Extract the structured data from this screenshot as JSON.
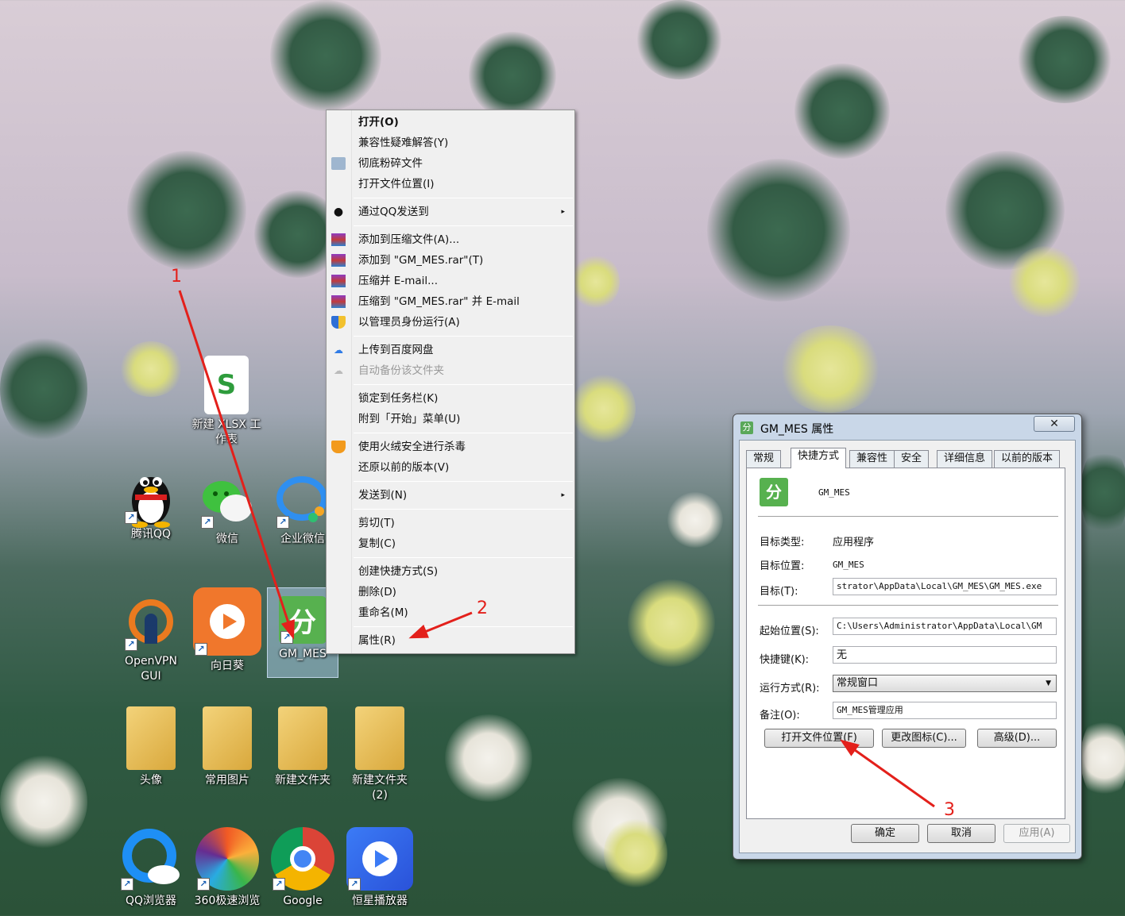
{
  "desktop": {
    "icons": [
      {
        "label": "新建 XLSX 工作表",
        "icon": "xlsx-file-icon"
      },
      {
        "label": "腾讯QQ",
        "icon": "qq-penguin-icon"
      },
      {
        "label": "微信",
        "icon": "wechat-icon"
      },
      {
        "label": "企业微信",
        "icon": "wecom-icon"
      },
      {
        "label": "OpenVPN GUI",
        "icon": "openvpn-icon"
      },
      {
        "label": "向日葵",
        "icon": "sunflower-icon"
      },
      {
        "label": "GM_MES",
        "icon": "gm-mes-app-icon"
      },
      {
        "label": "头像",
        "icon": "folder-icon"
      },
      {
        "label": "常用图片",
        "icon": "folder-icon"
      },
      {
        "label": "新建文件夹",
        "icon": "folder-icon"
      },
      {
        "label": "新建文件夹 (2)",
        "icon": "folder-icon"
      },
      {
        "label": "QQ浏览器",
        "icon": "qq-browser-icon"
      },
      {
        "label": "360极速浏览",
        "icon": "browser-360-icon"
      },
      {
        "label": "Google",
        "icon": "chrome-icon"
      },
      {
        "label": "恒星播放器",
        "icon": "video-player-icon"
      }
    ]
  },
  "context_menu": {
    "items": [
      {
        "label": "打开(O)",
        "bold": true
      },
      {
        "label": "兼容性疑难解答(Y)"
      },
      {
        "label": "彻底粉碎文件",
        "icon": "shredder-icon"
      },
      {
        "label": "打开文件位置(I)"
      },
      {
        "label": "通过QQ发送到",
        "icon": "qq-icon",
        "submenu": true
      },
      {
        "label": "添加到压缩文件(A)...",
        "icon": "winrar-icon"
      },
      {
        "label": "添加到 \"GM_MES.rar\"(T)",
        "icon": "winrar-icon"
      },
      {
        "label": "压缩并 E-mail...",
        "icon": "winrar-icon"
      },
      {
        "label": "压缩到 \"GM_MES.rar\" 并 E-mail",
        "icon": "winrar-icon"
      },
      {
        "label": "以管理员身份运行(A)",
        "icon": "uac-shield-icon"
      },
      {
        "label": "上传到百度网盘",
        "icon": "baidu-cloud-icon"
      },
      {
        "label": "自动备份该文件夹",
        "icon": "baidu-cloud-icon",
        "disabled": true
      },
      {
        "label": "锁定到任务栏(K)"
      },
      {
        "label": "附到「开始」菜单(U)"
      },
      {
        "label": "使用火绒安全进行杀毒",
        "icon": "huorong-icon"
      },
      {
        "label": "还原以前的版本(V)"
      },
      {
        "label": "发送到(N)",
        "submenu": true
      },
      {
        "label": "剪切(T)"
      },
      {
        "label": "复制(C)"
      },
      {
        "label": "创建快捷方式(S)"
      },
      {
        "label": "删除(D)"
      },
      {
        "label": "重命名(M)"
      },
      {
        "label": "属性(R)"
      }
    ],
    "submenu_arrow": "▸"
  },
  "dialog": {
    "title": "GM_MES 属性",
    "close": "✕",
    "tabs": [
      "常规",
      "快捷方式",
      "兼容性",
      "安全",
      "详细信息",
      "以前的版本"
    ],
    "active_tab": "快捷方式",
    "app_name": "GM_MES",
    "target_type_label": "目标类型:",
    "target_type_value": "应用程序",
    "target_location_label": "目标位置:",
    "target_location_value": "GM_MES",
    "target_label": "目标(T):",
    "target_value": "strator\\AppData\\Local\\GM_MES\\GM_MES.exe",
    "start_in_label": "起始位置(S):",
    "start_in_value": "C:\\Users\\Administrator\\AppData\\Local\\GM",
    "shortcut_key_label": "快捷键(K):",
    "shortcut_key_value": "无",
    "run_label": "运行方式(R):",
    "run_value": "常规窗口",
    "comment_label": "备注(O):",
    "comment_value": "GM_MES管理应用",
    "open_location_button": "打开文件位置(F)",
    "change_icon_button": "更改图标(C)...",
    "advanced_button": "高级(D)...",
    "ok_button": "确定",
    "cancel_button": "取消",
    "apply_button": "应用(A)"
  },
  "annotations": {
    "step1": "1",
    "step2": "2",
    "step3": "3",
    "color": "#e3201b"
  }
}
